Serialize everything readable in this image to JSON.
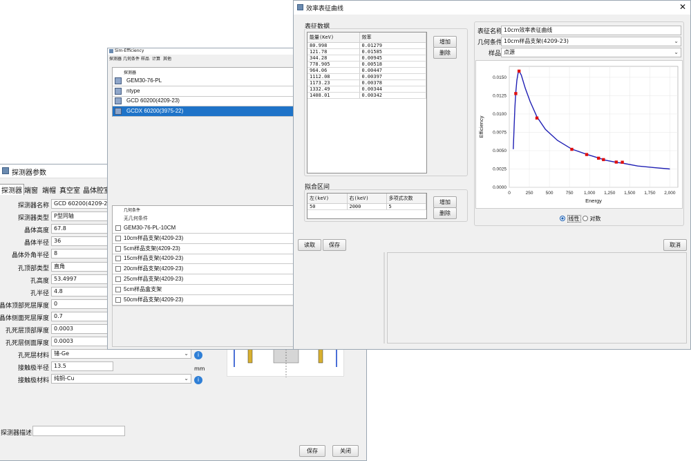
{
  "detector_window": {
    "title": "探测器参数",
    "tabs": [
      "探测器",
      "端窗",
      "端帽",
      "真空室",
      "晶体腔室"
    ],
    "fields": [
      {
        "label": "探测器名称",
        "value": "GCD 60200(4209-23)"
      },
      {
        "label": "探测器类型",
        "value": "P型同轴"
      },
      {
        "label": "晶体高度",
        "value": "67.8"
      },
      {
        "label": "晶体半径",
        "value": "36"
      },
      {
        "label": "晶体外角半径",
        "value": "8"
      },
      {
        "label": "孔顶部类型",
        "value": "直角"
      },
      {
        "label": "孔高度",
        "value": "53.4997"
      },
      {
        "label": "孔半径",
        "value": "4.8"
      },
      {
        "label": "晶体顶部死层厚度",
        "value": "0"
      },
      {
        "label": "晶体侧面死层厚度",
        "value": "0.7"
      },
      {
        "label": "孔死层顶部厚度",
        "value": "0.0003"
      },
      {
        "label": "孔死层侧面厚度",
        "value": "0.0003"
      },
      {
        "label": "孔死层材料",
        "value": "锗-Ge"
      },
      {
        "label": "接触极半径",
        "value": "13.5"
      },
      {
        "label": "接触极材料",
        "value": "纯铜-Cu"
      }
    ],
    "unit_mm": "mm",
    "desc_label": "探测器描述",
    "save": "保存",
    "close": "关闭"
  },
  "sim_window": {
    "title": "Sim-Efficiency",
    "menu": [
      "探测器",
      "几何条件",
      "样品",
      "计算",
      "其他"
    ],
    "detector_header": "探测器",
    "detectors": [
      "GEM30-76-PL",
      "ntype",
      "GCD 60200(4209-23)",
      "GCDX 60200(3975-22)"
    ],
    "geometry_header": "几何条件",
    "geometry_subheader": "无几何条件",
    "geometries": [
      "GEM30-76-PL-10CM",
      "10cm样品支架(4209-23)",
      "5cm样品支架(4209-23)",
      "15cm样品支架(4209-23)",
      "20cm样品支架(4209-23)",
      "25cm样品支架(4209-23)",
      "5cm样品盒支架",
      "50cm样品支架(4209-23)"
    ]
  },
  "eff_window": {
    "title": "效率表征曲线",
    "data_group": "表征数据",
    "col_energy": "能量(KeV)",
    "col_eff": "效率",
    "rows": [
      [
        "80.998",
        "0.01279"
      ],
      [
        "121.78",
        "0.01585"
      ],
      [
        "344.28",
        "0.00945"
      ],
      [
        "778.905",
        "0.00518"
      ],
      [
        "964.06",
        "0.00447"
      ],
      [
        "1112.08",
        "0.00397"
      ],
      [
        "1173.23",
        "0.00378"
      ],
      [
        "1332.49",
        "0.00344"
      ],
      [
        "1408.01",
        "0.00342"
      ]
    ],
    "add": "增加",
    "delete": "删除",
    "fit_group": "拟合区间",
    "fit_cols": [
      "左(keV)",
      "右(keV)",
      "多项式次数"
    ],
    "fit_values": [
      "50",
      "2000",
      "5"
    ],
    "name_label": "表征名称",
    "name_value": "10cm效率表征曲线",
    "geo_label": "几何条件",
    "geo_value": "10cm样品支架(4209-23)",
    "sample_label": "样品",
    "sample_value": "点源",
    "radio_linear": "线性",
    "radio_log": "对数",
    "read": "读取",
    "save": "保存",
    "cancel": "取消"
  },
  "chart_data": {
    "type": "line",
    "xlabel": "Energy",
    "ylabel": "Efficiency",
    "xlim": [
      0,
      2100
    ],
    "ylim": [
      0,
      0.0165
    ],
    "xticks": [
      "0",
      "250",
      "500",
      "750",
      "1,000",
      "1,250",
      "1,500",
      "1,750",
      "2,000"
    ],
    "yticks": [
      "0.0000",
      "0.0025",
      "0.0050",
      "0.0075",
      "0.0100",
      "0.0125",
      "0.0150"
    ],
    "curve": [
      [
        50,
        0.0052
      ],
      [
        60,
        0.0082
      ],
      [
        70,
        0.0108
      ],
      [
        80,
        0.0128
      ],
      [
        95,
        0.0146
      ],
      [
        110,
        0.0156
      ],
      [
        125,
        0.0158
      ],
      [
        150,
        0.0153
      ],
      [
        200,
        0.0135
      ],
      [
        260,
        0.0117
      ],
      [
        345,
        0.0096
      ],
      [
        450,
        0.0079
      ],
      [
        600,
        0.0064
      ],
      [
        780,
        0.0052
      ],
      [
        965,
        0.0045
      ],
      [
        1112,
        0.004
      ],
      [
        1200,
        0.0037
      ],
      [
        1333,
        0.0034
      ],
      [
        1408,
        0.0033
      ],
      [
        1600,
        0.0029
      ],
      [
        1800,
        0.0027
      ],
      [
        2000,
        0.0025
      ]
    ],
    "points": [
      [
        80.998,
        0.01279
      ],
      [
        121.78,
        0.01585
      ],
      [
        344.28,
        0.00945
      ],
      [
        778.905,
        0.00518
      ],
      [
        964.06,
        0.00447
      ],
      [
        1112.08,
        0.00397
      ],
      [
        1173.23,
        0.00378
      ],
      [
        1332.49,
        0.00344
      ],
      [
        1408.01,
        0.00342
      ]
    ],
    "line_color": "#1f1fb4",
    "point_color": "#e01010"
  }
}
